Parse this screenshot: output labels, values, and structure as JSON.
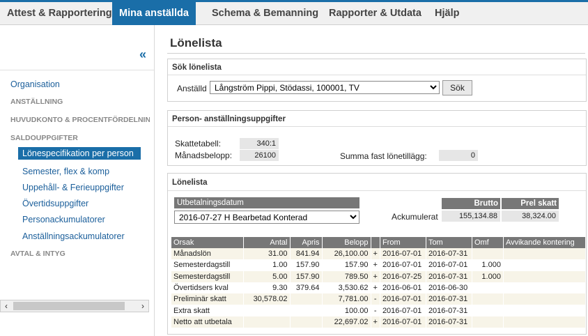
{
  "nav": {
    "tabs": [
      {
        "label": "Attest & Rapportering"
      },
      {
        "label": "Mina anställda"
      },
      {
        "label": "Schema & Bemanning"
      },
      {
        "label": "Rapporter & Utdata"
      },
      {
        "label": "Hjälp"
      }
    ],
    "active_index": 1
  },
  "sidebar": {
    "collapse_glyph": "«",
    "items": [
      {
        "label": "Organisation"
      },
      {
        "label": "ANSTÄLLNING"
      },
      {
        "label": "HUVUDKONTO & PROCENTFÖRDELNING"
      },
      {
        "label": "SALDOUPPGIFTER"
      },
      {
        "label": "Lönespecifikation per person"
      },
      {
        "label": "Semester, flex & komp"
      },
      {
        "label": "Uppehåll- & Ferieuppgifter"
      },
      {
        "label": "Övertidsuppgifter"
      },
      {
        "label": "Personackumulatorer"
      },
      {
        "label": "Anställningsackumulatorer"
      },
      {
        "label": "AVTAL & INTYG"
      }
    ],
    "scroll_left": "‹",
    "scroll_right": "›"
  },
  "page": {
    "title": "Lönelista"
  },
  "search": {
    "header": "Sök lönelista",
    "employee_label": "Anställd",
    "employee_value": "Långström Pippi, Stödassi, 100001, TV",
    "search_button": "Sök"
  },
  "person": {
    "header": "Person- anställningsuppgifter",
    "tax_table_label": "Skattetabell:",
    "tax_table_value": "340:1",
    "monthly_label": "Månadsbelopp:",
    "monthly_value": "26100",
    "fixed_sum_label": "Summa fast lönetillägg:",
    "fixed_sum_value": "0"
  },
  "payroll": {
    "header": "Lönelista",
    "payout_date_label": "Utbetalningsdatum",
    "payout_date_value": "2016-07-27 H Bearbetad Konterad",
    "gross_label": "Brutto",
    "prel_tax_label": "Prel skatt",
    "accumulated_label": "Ackumulerat",
    "accumulated_gross": "155,134.88",
    "accumulated_tax": "38,324.00",
    "columns": [
      "Orsak",
      "Antal",
      "Apris",
      "Belopp",
      "",
      "From",
      "Tom",
      "Omf",
      "Avvikande kontering"
    ],
    "rows": [
      {
        "orsak": "Månadslön",
        "antal": "31.00",
        "apris": "841.94",
        "belopp": "26,100.00",
        "sign": "+",
        "from": "2016-07-01",
        "tom": "2016-07-31",
        "omf": "",
        "avvik": ""
      },
      {
        "orsak": "Semesterdagstill",
        "antal": "1.00",
        "apris": "157.90",
        "belopp": "157.90",
        "sign": "+",
        "from": "2016-07-01",
        "tom": "2016-07-01",
        "omf": "1.000",
        "avvik": ""
      },
      {
        "orsak": "Semesterdagstill",
        "antal": "5.00",
        "apris": "157.90",
        "belopp": "789.50",
        "sign": "+",
        "from": "2016-07-25",
        "tom": "2016-07-31",
        "omf": "1.000",
        "avvik": ""
      },
      {
        "orsak": "Övertidsers kval",
        "antal": "9.30",
        "apris": "379.64",
        "belopp": "3,530.62",
        "sign": "+",
        "from": "2016-06-01",
        "tom": "2016-06-30",
        "omf": "",
        "avvik": ""
      },
      {
        "orsak": "Preliminär skatt",
        "antal": "30,578.02",
        "apris": "",
        "belopp": "7,781.00",
        "sign": "-",
        "from": "2016-07-01",
        "tom": "2016-07-31",
        "omf": "",
        "avvik": ""
      },
      {
        "orsak": "Extra skatt",
        "antal": "",
        "apris": "",
        "belopp": "100.00",
        "sign": "-",
        "from": "2016-07-01",
        "tom": "2016-07-31",
        "omf": "",
        "avvik": ""
      },
      {
        "orsak": "Netto att utbetala",
        "antal": "",
        "apris": "",
        "belopp": "22,697.02",
        "sign": "+",
        "from": "2016-07-01",
        "tom": "2016-07-31",
        "omf": "",
        "avvik": ""
      }
    ]
  },
  "colors": {
    "accent": "#1a6ea8",
    "header_grey": "#777777",
    "row_tint": "#f7f4e8"
  }
}
